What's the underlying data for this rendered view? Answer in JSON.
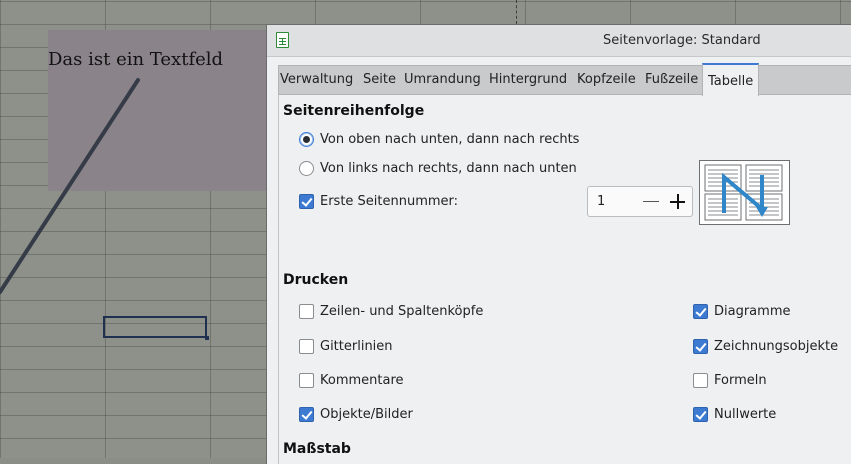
{
  "sheet": {
    "textbox_text": "Das ist ein Textfeld"
  },
  "dialog": {
    "title": "Seitenvorlage: Standard",
    "tabs": [
      {
        "label": "Verwaltung",
        "active": false
      },
      {
        "label": "Seite",
        "active": false
      },
      {
        "label": "Umrandung",
        "active": false
      },
      {
        "label": "Hintergrund",
        "active": false
      },
      {
        "label": "Kopfzeile",
        "active": false
      },
      {
        "label": "Fußzeile",
        "active": false
      },
      {
        "label": "Tabelle",
        "active": true
      }
    ],
    "page_order": {
      "heading": "Seitenreihenfolge",
      "options": [
        {
          "label": "Von oben nach unten, dann nach rechts",
          "selected": true
        },
        {
          "label": "Von links nach rechts, dann nach unten",
          "selected": false
        }
      ],
      "first_page_number": {
        "label": "Erste Seitennummer:",
        "checked": true,
        "value": "1"
      }
    },
    "print": {
      "heading": "Drucken",
      "left": [
        {
          "label": "Zeilen- und Spaltenköpfe",
          "checked": false
        },
        {
          "label": "Gitterlinien",
          "checked": false
        },
        {
          "label": "Kommentare",
          "checked": false
        },
        {
          "label": "Objekte/Bilder",
          "checked": true
        }
      ],
      "right": [
        {
          "label": "Diagramme",
          "checked": true
        },
        {
          "label": "Zeichnungsobjekte",
          "checked": true
        },
        {
          "label": "Formeln",
          "checked": false
        },
        {
          "label": "Nullwerte",
          "checked": true
        }
      ]
    },
    "scale": {
      "heading": "Maßstab"
    },
    "colors": {
      "accent": "#3d7bd2",
      "order_arrow": "#2f86c9"
    }
  }
}
